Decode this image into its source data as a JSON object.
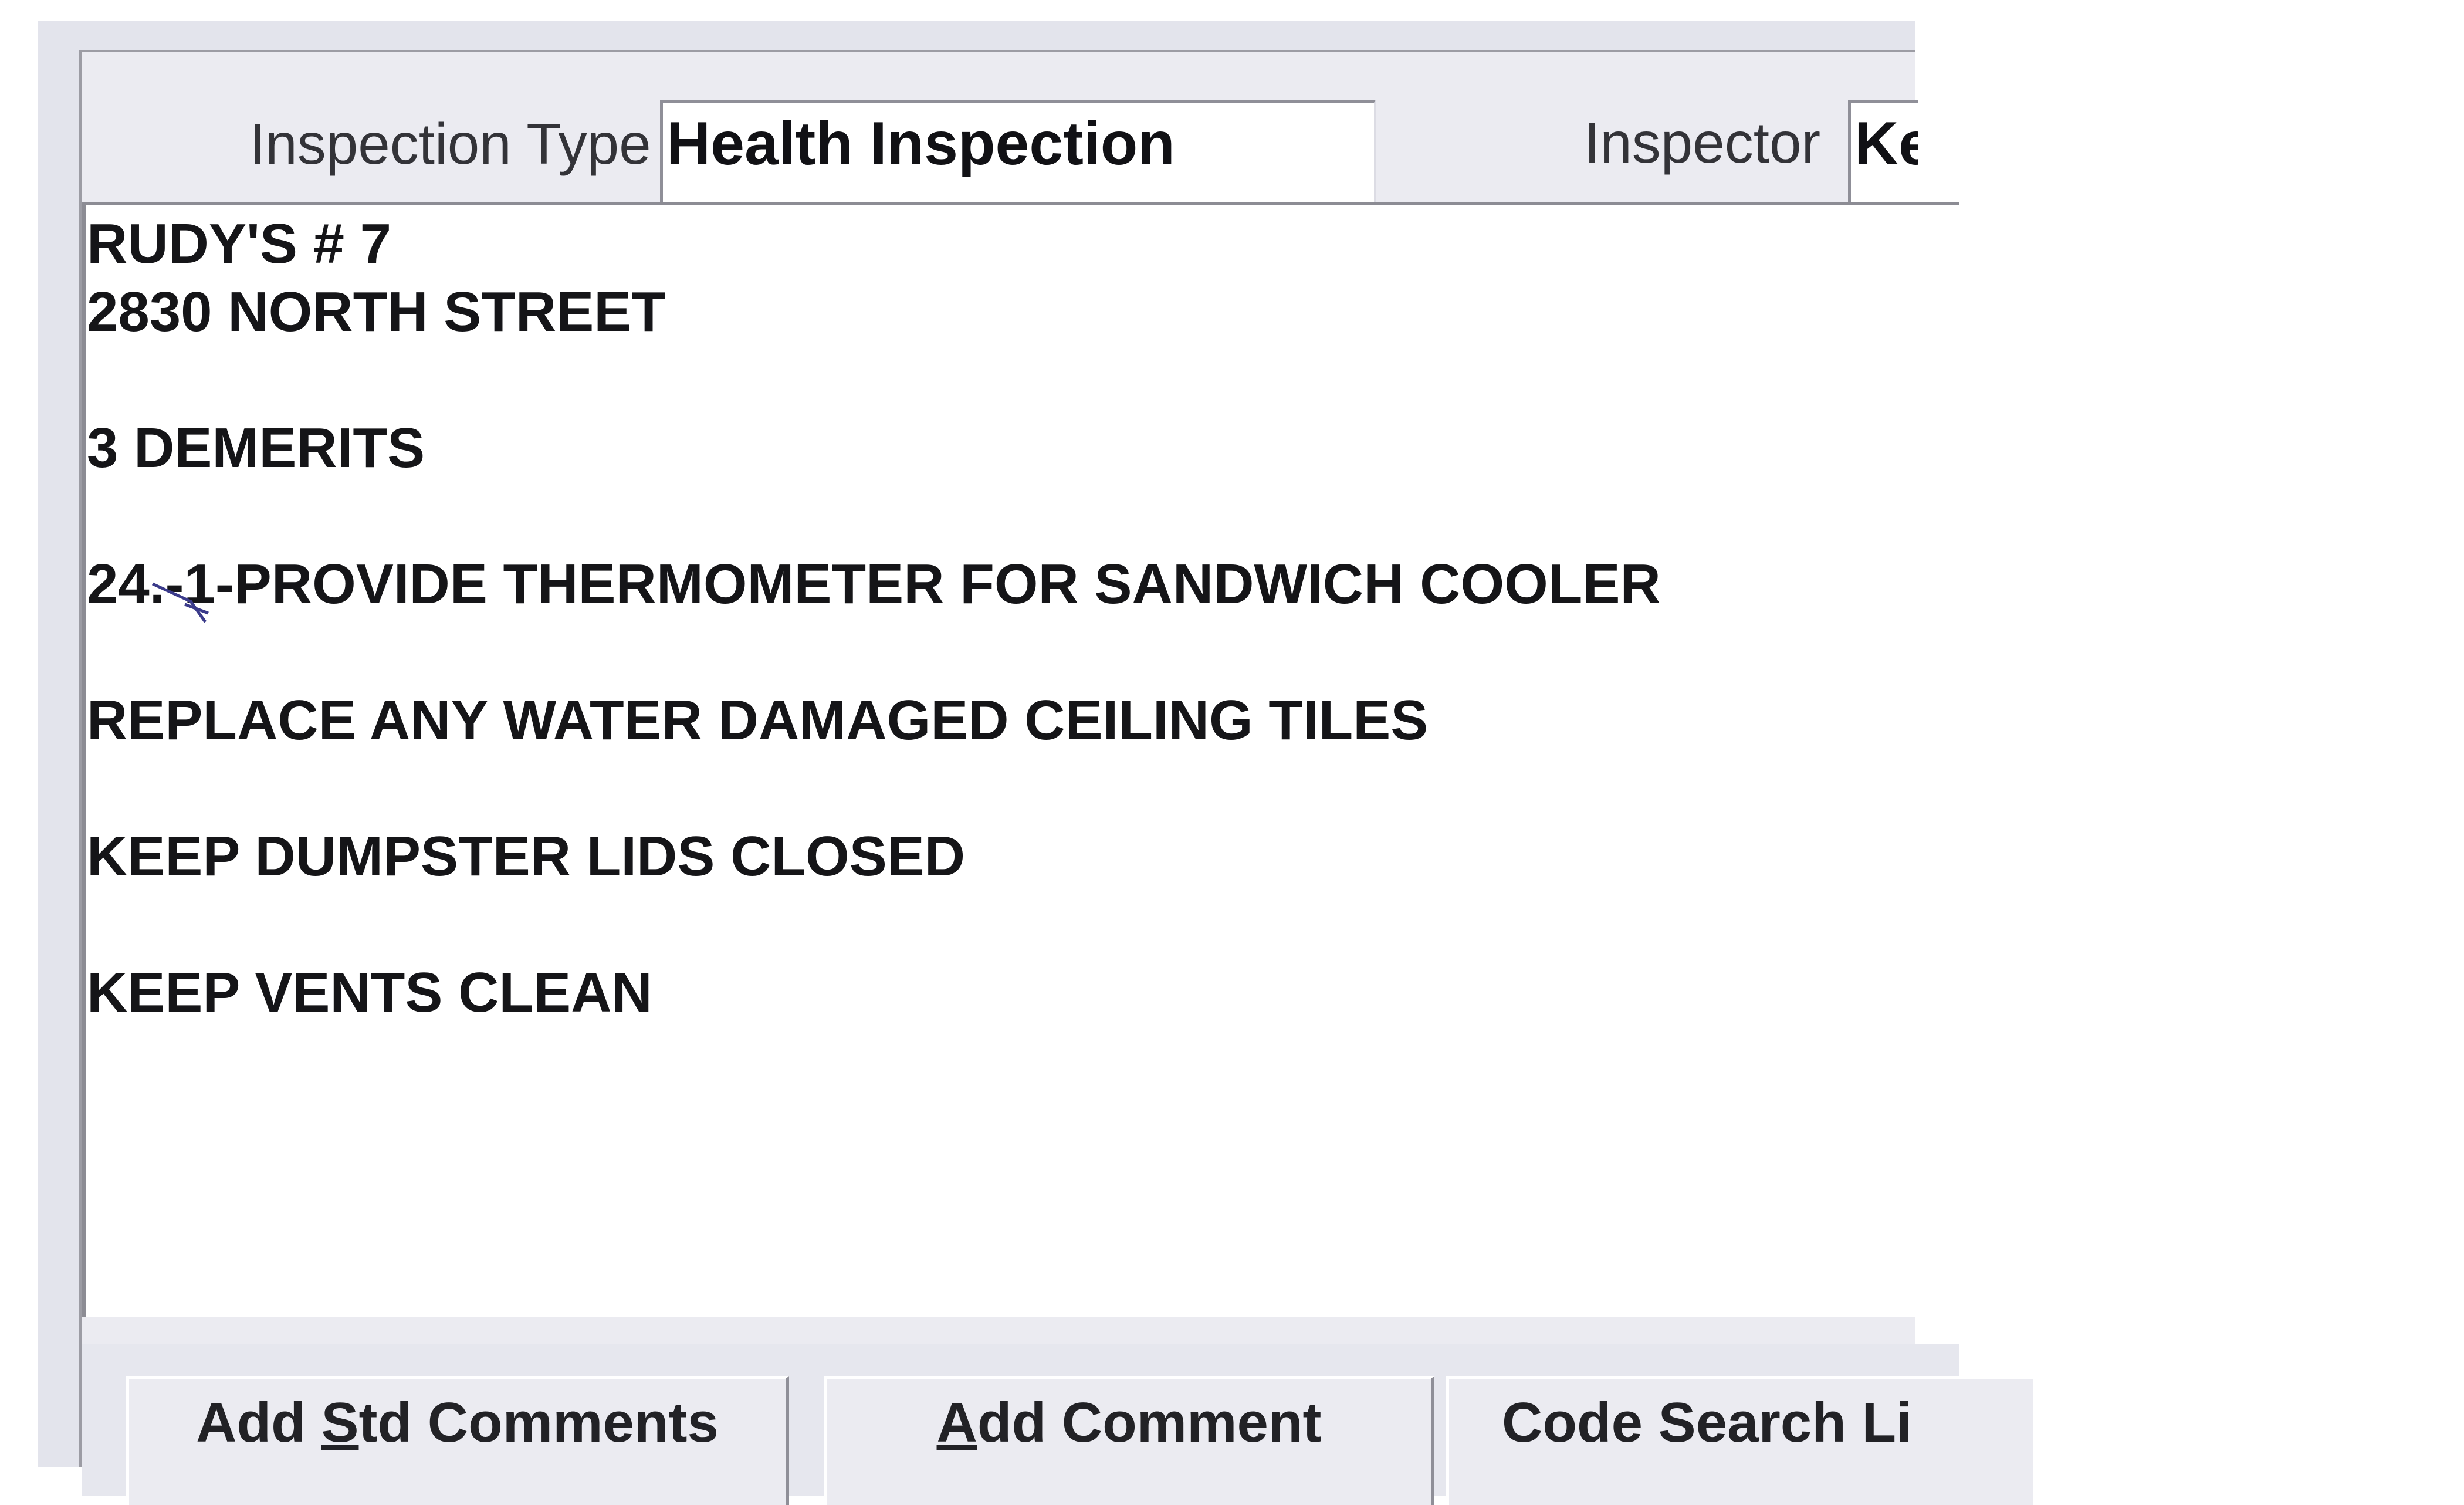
{
  "header": {
    "inspection_type_label": "Inspection Type",
    "inspection_type_value": "Health Inspection",
    "inspector_label": "Inspector",
    "inspector_value": "Ke"
  },
  "comments": {
    "lines": [
      "RUDY'S # 7",
      "2830 NORTH STREET",
      "",
      "3 DEMERITS",
      "",
      "24.-1-PROVIDE THERMOMETER FOR SANDWICH COOLER",
      "",
      "REPLACE ANY WATER DAMAGED CEILING TILES",
      "",
      "KEEP DUMPSTER LIDS CLOSED",
      "",
      "KEEP VENTS CLEAN"
    ]
  },
  "buttons": {
    "add_std_comments": {
      "pre": "Add ",
      "mnemonic": "S",
      "post": "td Comments"
    },
    "add_comment": {
      "pre": "",
      "mnemonic": "A",
      "post": "dd Comment"
    },
    "code_search": {
      "pre": "Code Search Li",
      "mnemonic": "",
      "post": ""
    }
  },
  "colors": {
    "window_bg": "#e3e4ec",
    "field_bg": "#ffffff",
    "text": "#151518"
  }
}
